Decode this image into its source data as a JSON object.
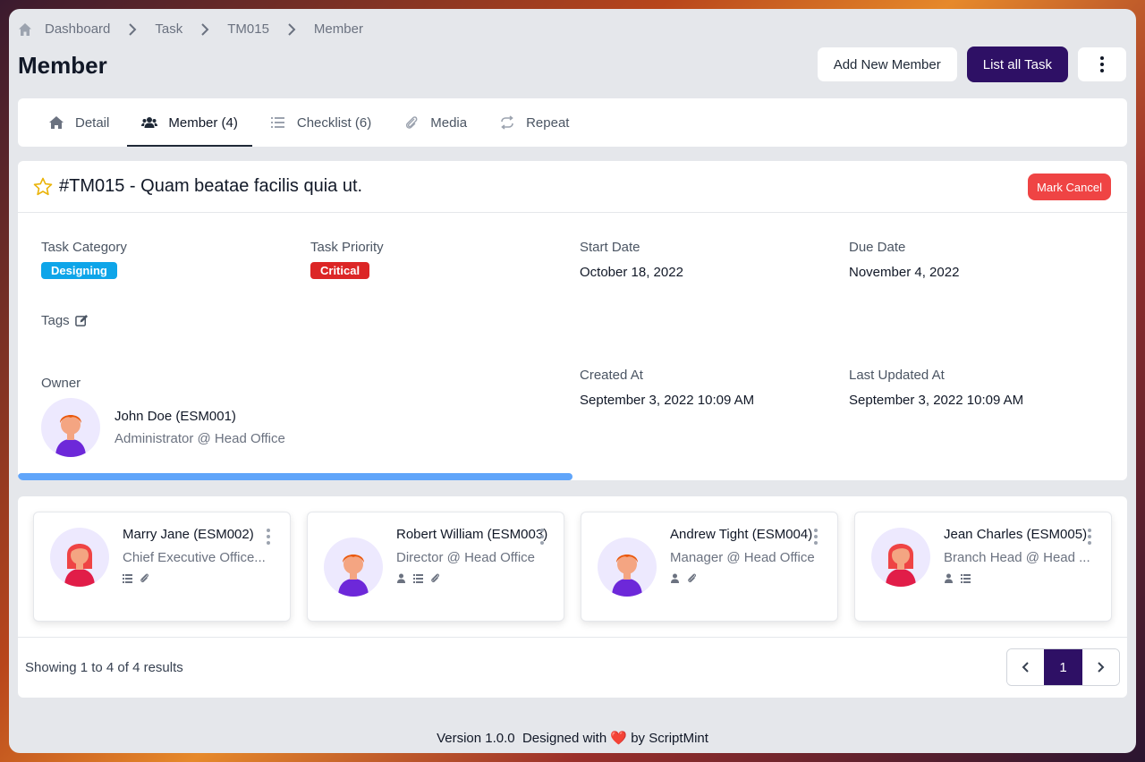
{
  "breadcrumb": {
    "home": "Dashboard",
    "items": [
      "Task",
      "TM015",
      "Member"
    ]
  },
  "page": {
    "title": "Member"
  },
  "actions": {
    "add_member": "Add New Member",
    "list_task": "List all Task"
  },
  "tabs": [
    {
      "label": "Detail",
      "icon": "home-icon"
    },
    {
      "label": "Member (4)",
      "icon": "users-icon",
      "active": true
    },
    {
      "label": "Checklist (6)",
      "icon": "list-icon"
    },
    {
      "label": "Media",
      "icon": "paperclip-icon"
    },
    {
      "label": "Repeat",
      "icon": "repeat-icon"
    }
  ],
  "task": {
    "title": "#TM015 - Quam beatae facilis quia ut.",
    "mark_cancel": "Mark Cancel",
    "category_label": "Task Category",
    "category": "Designing",
    "priority_label": "Task Priority",
    "priority": "Critical",
    "start_label": "Start Date",
    "start": "October 18, 2022",
    "due_label": "Due Date",
    "due": "November 4, 2022",
    "tags_label": "Tags",
    "owner_label": "Owner",
    "owner_name": "John Doe (ESM001)",
    "owner_role": "Administrator @ Head Office",
    "created_label": "Created At",
    "created": "September 3, 2022 10:09 AM",
    "updated_label": "Last Updated At",
    "updated": "September 3, 2022 10:09 AM",
    "progress": 0.5
  },
  "members": [
    {
      "name": "Marry Jane (ESM002)",
      "role": "Chief Executive Office...",
      "gender": "female",
      "icons": [
        "list-icon",
        "paperclip-icon"
      ]
    },
    {
      "name": "Robert William (ESM003)",
      "role": "Director @ Head Office",
      "gender": "male",
      "icons": [
        "user-icon",
        "list-icon",
        "paperclip-icon"
      ]
    },
    {
      "name": "Andrew Tight (ESM004)",
      "role": "Manager @ Head Office",
      "gender": "male",
      "icons": [
        "user-icon",
        "paperclip-icon"
      ]
    },
    {
      "name": "Jean Charles (ESM005)",
      "role": "Branch Head @ Head ...",
      "gender": "female",
      "icons": [
        "user-icon",
        "list-icon"
      ]
    }
  ],
  "pagination": {
    "summary": "Showing 1 to 4 of 4 results",
    "current": "1"
  },
  "footer": {
    "version": "Version 1.0.0",
    "designed": "Designed with",
    "by": "by ScriptMint"
  },
  "colors": {
    "primary": "#2e1065",
    "danger": "#ef4444",
    "info": "#0ea5e9",
    "progress": "#60a5fa"
  }
}
